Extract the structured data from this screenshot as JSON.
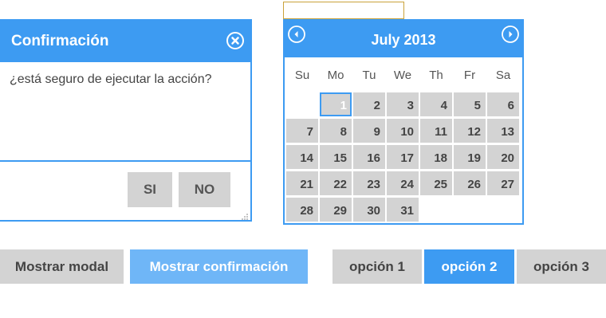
{
  "dialog": {
    "title": "Confirmación",
    "message": "¿está seguro de ejecutar la acción?",
    "yes_label": "SI",
    "no_label": "NO"
  },
  "calendar": {
    "title": "July 2013",
    "days_of_week": [
      "Su",
      "Mo",
      "Tu",
      "We",
      "Th",
      "Fr",
      "Sa"
    ],
    "selected_day": "1",
    "weeks": [
      [
        "",
        "1",
        "2",
        "3",
        "4",
        "5",
        "6"
      ],
      [
        "7",
        "8",
        "9",
        "10",
        "11",
        "12",
        "13"
      ],
      [
        "14",
        "15",
        "16",
        "17",
        "18",
        "19",
        "20"
      ],
      [
        "21",
        "22",
        "23",
        "24",
        "25",
        "26",
        "27"
      ],
      [
        "28",
        "29",
        "30",
        "31",
        "",
        "",
        ""
      ]
    ]
  },
  "date_input": {
    "value": ""
  },
  "buttons": {
    "show_modal": "Mostrar modal",
    "show_confirmation": "Mostrar confirmación",
    "option1": "opción 1",
    "option2": "opción 2",
    "option3": "opción 3"
  },
  "colors": {
    "accent": "#3d9bf2",
    "accent_light": "#6fb6f7",
    "neutral": "#d3d3d3"
  },
  "icons": {
    "close": "close-icon",
    "prev": "chevron-left-icon",
    "next": "chevron-right-icon"
  }
}
